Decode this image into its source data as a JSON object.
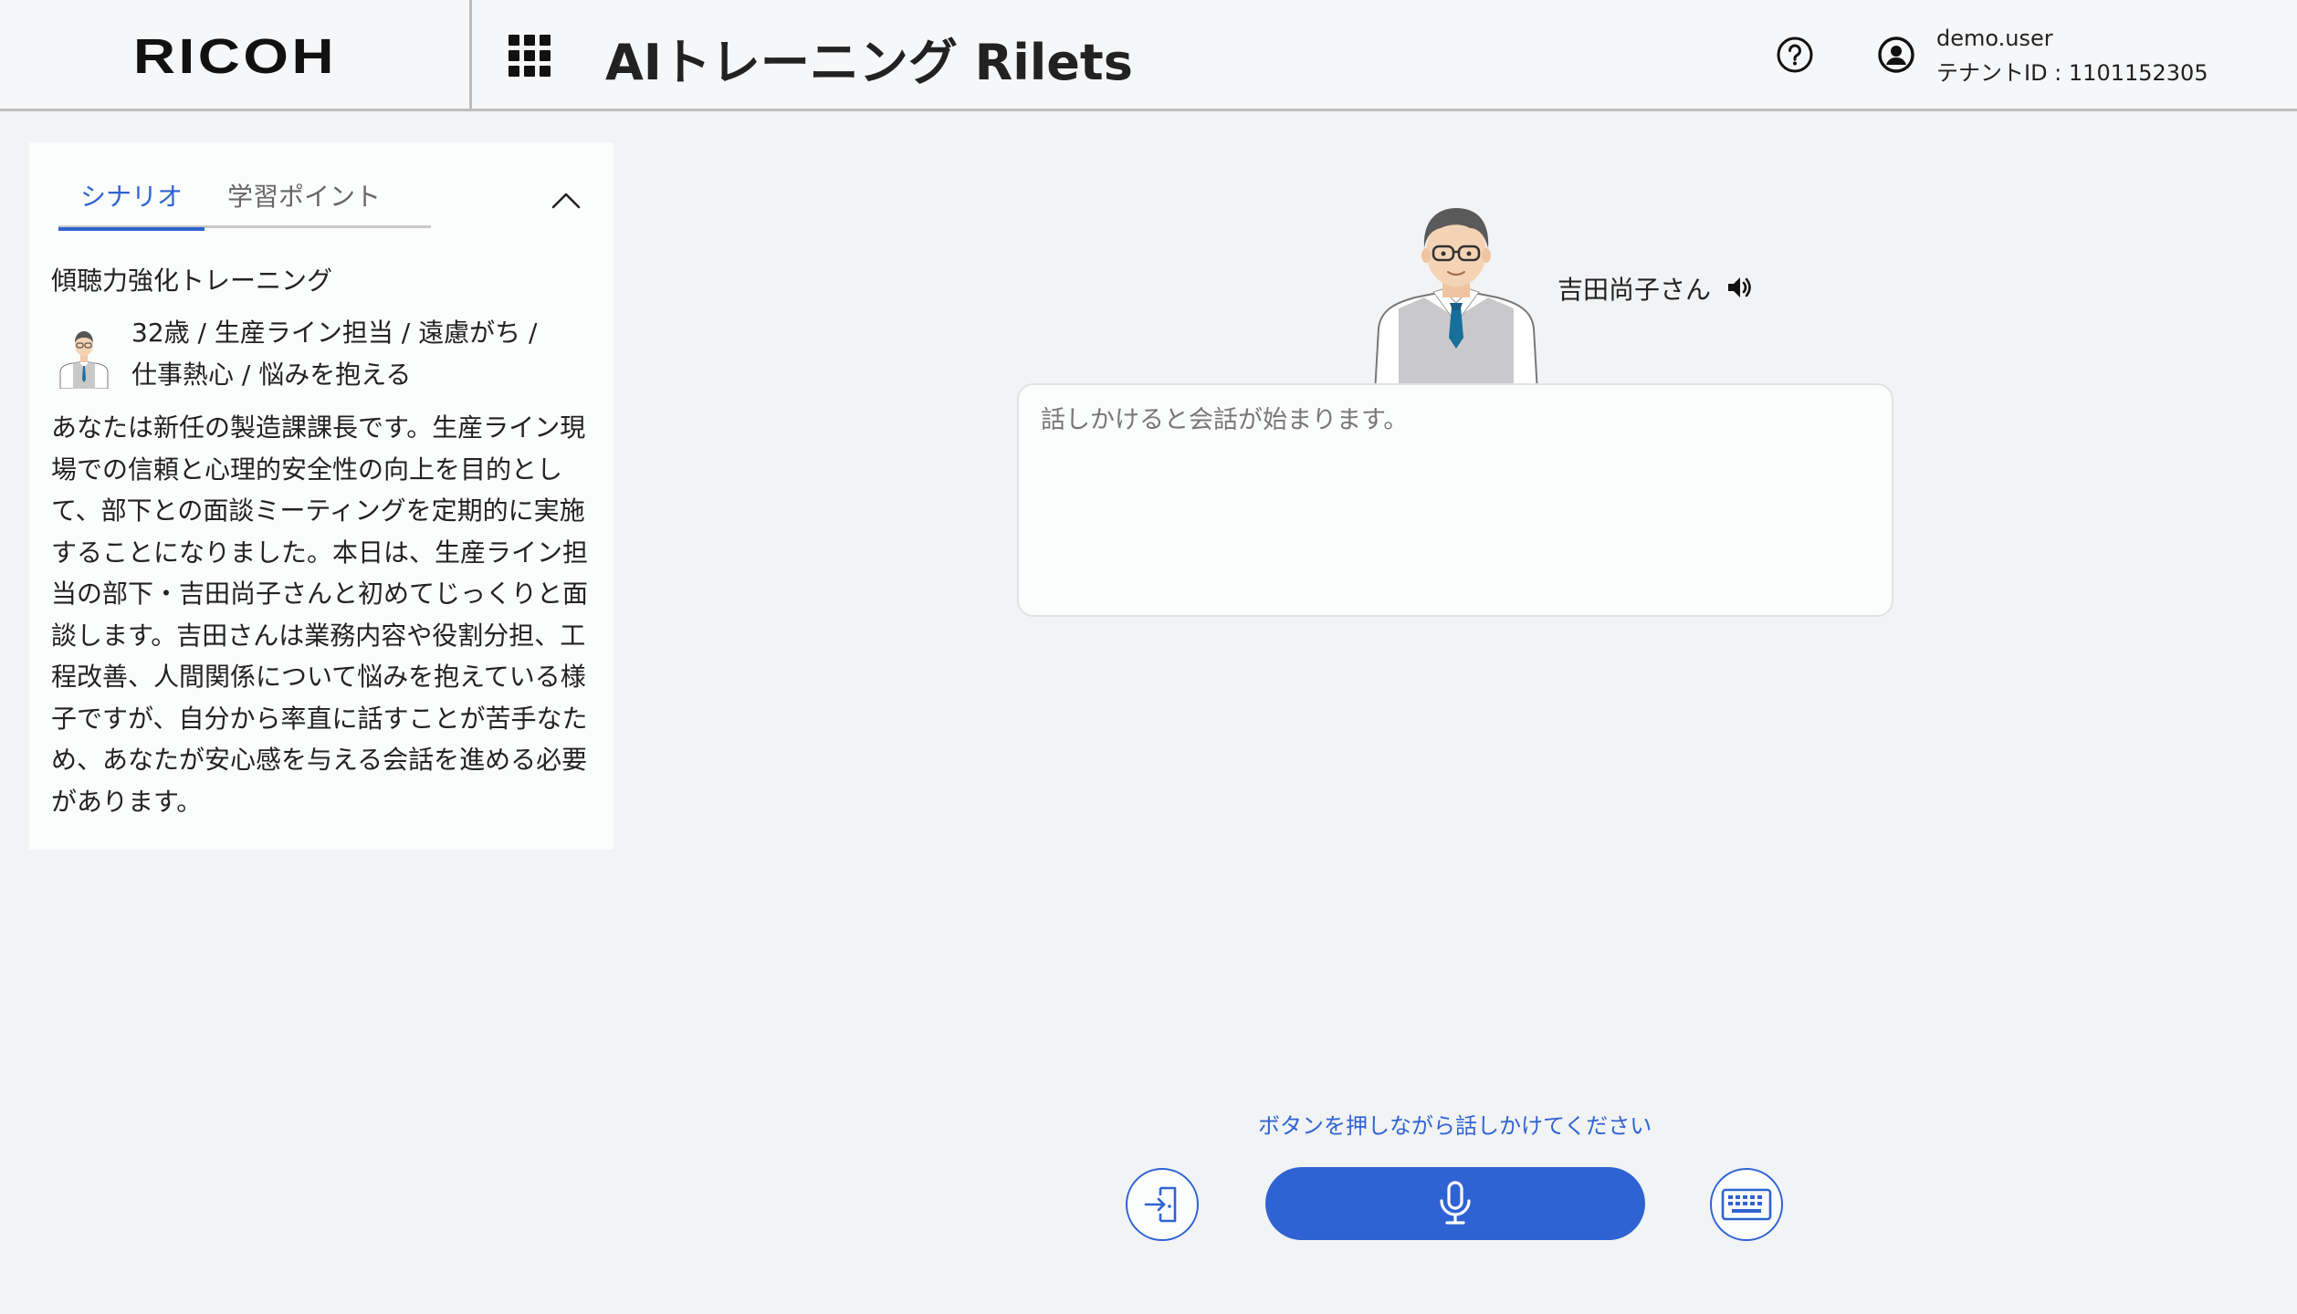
{
  "header": {
    "logo": "RICOH",
    "app_title": "AIトレーニング Rilets",
    "user_name": "demo.user",
    "tenant": "テナントID : 1101152305",
    "icons": [
      "apps-grid-icon",
      "help-icon",
      "user-icon"
    ]
  },
  "panel": {
    "tabs": [
      {
        "label": "シナリオ",
        "active": true
      },
      {
        "label": "学習ポイント",
        "active": false
      }
    ],
    "scenario_title": "傾聴力強化トレーニング",
    "profile_line1": "32歳 / 生産ライン担当 / 遠慮がち /",
    "profile_line2": "仕事熱心 / 悩みを抱える",
    "description": "あなたは新任の製造課課長です。生産ライン現場での信頼と心理的安全性の向上を目的として、部下との面談ミーティングを定期的に実施することになりました。本日は、生産ライン担当の部下・吉田尚子さんと初めてじっくりと面談します。吉田さんは業務内容や役割分担、工程改善、人間関係について悩みを抱えている様子ですが、自分から率直に話すことが苦手なため、あなたが安心感を与える会話を進める必要があります。"
  },
  "conversation": {
    "speaker_name": "吉田尚子さん",
    "placeholder": "話しかけると会話が始まります。",
    "hint": "ボタンを押しながら話しかけてください"
  },
  "colors": {
    "accent": "#2f63d3",
    "background": "#f2f3f5",
    "panel": "#fbfcfc"
  }
}
